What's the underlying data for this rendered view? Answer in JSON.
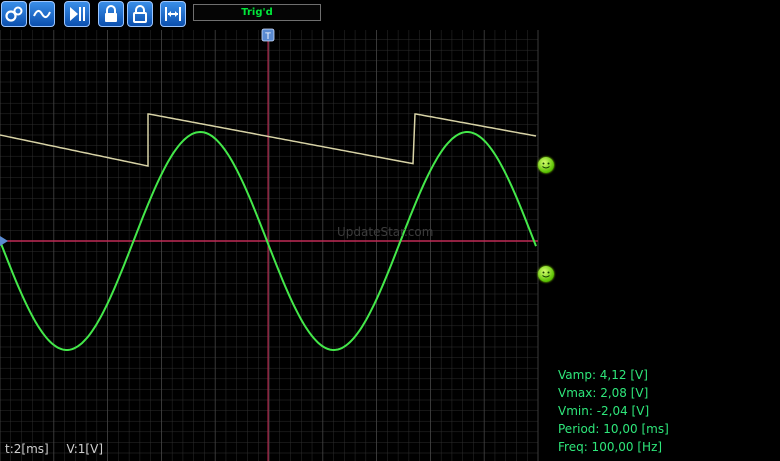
{
  "toolbar": {
    "buttons": [
      {
        "name": "settings-gears-icon",
        "label": ""
      },
      {
        "name": "waveform-icon",
        "label": ""
      },
      {
        "name": "play-pause-icon",
        "label": ""
      },
      {
        "name": "lock-channel-1-icon",
        "label": ""
      },
      {
        "name": "lock-channel-2-icon",
        "label": ""
      },
      {
        "name": "measure-span-icon",
        "label": ""
      }
    ],
    "status": "Trig'd"
  },
  "trigger_marker": "T",
  "watermark": "UpdateStar.com",
  "bottom": {
    "timebase": "t:2[ms]",
    "volts": "V:1[V]"
  },
  "measurements": {
    "vamp": "Vamp: 4,12 [V]",
    "vmax": "Vmax: 2,08 [V]",
    "vmin": "Vmin: -2,04 [V]",
    "period": "Period: 10,00 [ms]",
    "freq": "Freq: 100,00 [Hz]"
  },
  "colors": {
    "grid": "#2e2e2e",
    "trace_sine": "#44e84a",
    "trace_saw": "#d8d3a6",
    "trigger_line": "#c4224e",
    "measure_text": "#2ee67a"
  }
}
